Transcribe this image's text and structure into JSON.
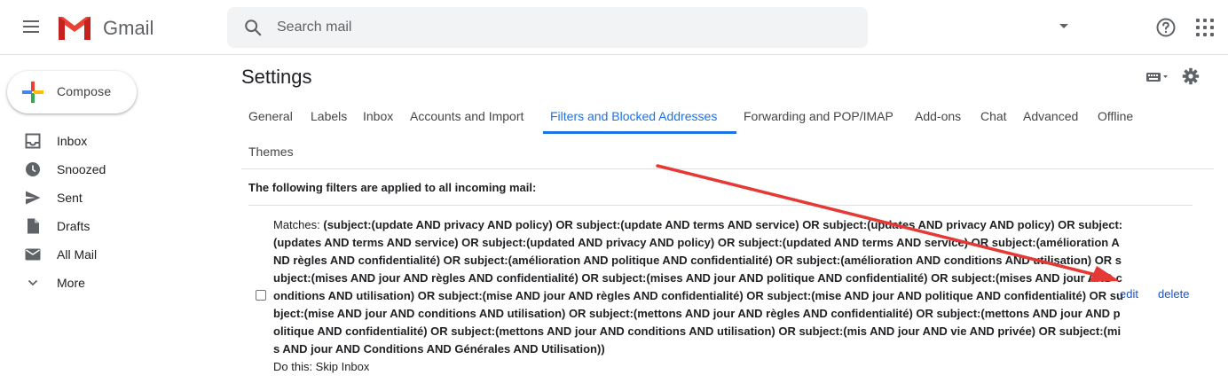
{
  "app": {
    "name": "Gmail"
  },
  "search": {
    "placeholder": "Search mail"
  },
  "compose": {
    "label": "Compose"
  },
  "sidebar": {
    "items": [
      {
        "label": "Inbox",
        "icon": "inbox-icon"
      },
      {
        "label": "Snoozed",
        "icon": "clock-icon"
      },
      {
        "label": "Sent",
        "icon": "send-icon"
      },
      {
        "label": "Drafts",
        "icon": "draft-icon"
      },
      {
        "label": "All Mail",
        "icon": "mail-icon"
      },
      {
        "label": "More",
        "icon": "chevron-down-icon"
      }
    ]
  },
  "settings": {
    "title": "Settings",
    "tabs": [
      {
        "label": "General"
      },
      {
        "label": "Labels"
      },
      {
        "label": "Inbox"
      },
      {
        "label": "Accounts and Import"
      },
      {
        "label": "Filters and Blocked Addresses",
        "active": true
      },
      {
        "label": "Forwarding and POP/IMAP"
      },
      {
        "label": "Add-ons"
      },
      {
        "label": "Chat"
      },
      {
        "label": "Advanced"
      },
      {
        "label": "Offline"
      },
      {
        "label": "Themes"
      }
    ],
    "filters_heading": "The following filters are applied to all incoming mail:",
    "filter": {
      "matches_label": "Matches: ",
      "criteria": "(subject:(update AND privacy AND policy) OR subject:(update AND terms AND service) OR subject:(updates AND privacy AND policy) OR subject:(updates AND terms AND service) OR subject:(updated AND privacy AND policy) OR subject:(updated AND terms AND service) OR subject:(amélioration AND règles AND confidentialité) OR subject:(amélioration AND politique AND confidentialité) OR subject:(amélioration AND conditions AND utilisation) OR subject:(mises AND jour AND règles AND confidentialité) OR subject:(mises AND jour AND politique AND confidentialité) OR subject:(mises AND jour AND conditions AND utilisation) OR subject:(mise AND jour AND règles AND confidentialité) OR subject:(mise AND jour AND politique AND confidentialité) OR subject:(mise AND jour AND conditions AND utilisation) OR subject:(mettons AND jour AND règles AND confidentialité) OR subject:(mettons AND jour AND politique AND confidentialité) OR subject:(mettons AND jour AND conditions AND utilisation) OR subject:(mis AND jour AND vie AND privée) OR subject:(mis AND jour AND Conditions AND Générales AND Utilisation))",
      "action": "Do this: Skip Inbox",
      "edit_label": "edit",
      "delete_label": "delete"
    }
  },
  "colors": {
    "accent": "#1a73e8",
    "annotation_arrow": "#e53935"
  }
}
